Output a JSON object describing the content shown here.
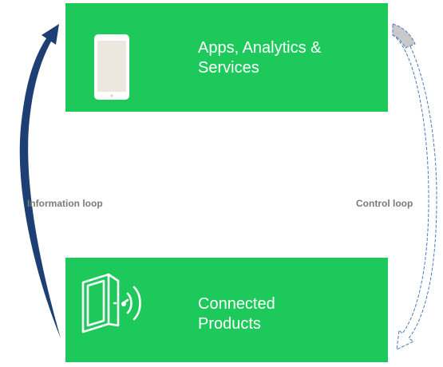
{
  "boxes": {
    "top": {
      "label": "Apps, Analytics &\nServices"
    },
    "bottom": {
      "label": "Connected\nProducts"
    }
  },
  "loops": {
    "information": {
      "label": "Information loop"
    },
    "control": {
      "label": "Control loop"
    }
  },
  "colors": {
    "box_fill": "#1ec95c",
    "information_arrow": "#1d3f73",
    "control_arrow_stroke": "#4a79c2",
    "control_arrow_fill": "#c9c9c9",
    "loop_label": "#7a7a7a"
  },
  "icons": {
    "top": "tablet-icon",
    "bottom": "smart-door-icon"
  }
}
